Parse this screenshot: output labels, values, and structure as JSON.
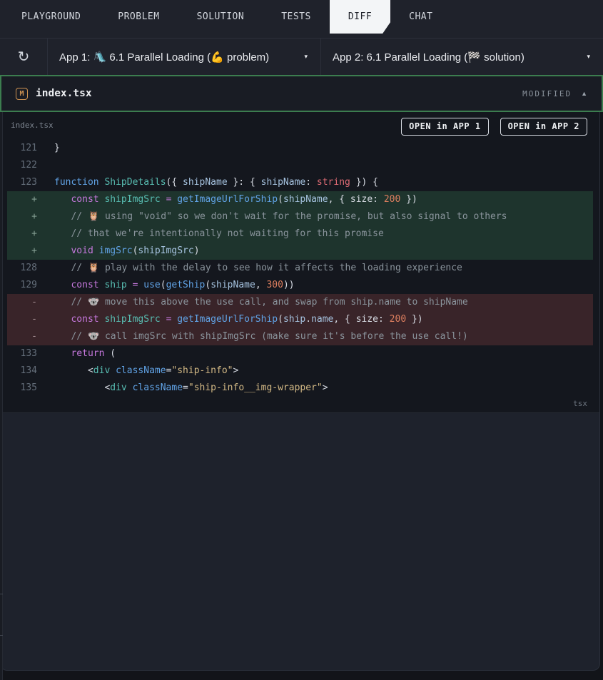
{
  "nav": {
    "tabs": [
      {
        "label": "PLAYGROUND",
        "active": false
      },
      {
        "label": "PROBLEM",
        "active": false
      },
      {
        "label": "SOLUTION",
        "active": false
      },
      {
        "label": "TESTS",
        "active": false
      },
      {
        "label": "DIFF",
        "active": true
      },
      {
        "label": "CHAT",
        "active": false
      }
    ]
  },
  "appbar": {
    "refresh_icon": "↻",
    "caret_icon": "▾",
    "app1_label": "App 1: 🛝 6.1 Parallel Loading (💪 problem)",
    "app2_label": "App 2: 6.1 Parallel Loading (🏁 solution)"
  },
  "file_header": {
    "badge": "M",
    "filename": "index.tsx",
    "status": "MODIFIED",
    "collapse_icon": "▲"
  },
  "colors": {
    "accent_green_border": "#3c7d4f",
    "modified_badge_orange": "#cf9352",
    "added_row_bg": "#1e342d",
    "removed_row_bg": "#392429",
    "active_tab_bg": "#f3f5f7"
  },
  "diff": {
    "file_label": "index.tsx",
    "buttons": [
      "OPEN in APP 1",
      "OPEN in APP 2"
    ],
    "lang_label": "tsx",
    "lines": [
      {
        "num": "121",
        "type": "ctx",
        "tokens": [
          [
            "pl",
            "}"
          ]
        ]
      },
      {
        "num": "122",
        "type": "ctx",
        "tokens": []
      },
      {
        "num": "123",
        "type": "ctx",
        "tokens": [
          [
            "kwb",
            "function "
          ],
          [
            "teal",
            "ShipDetails"
          ],
          [
            "pl",
            "({ "
          ],
          [
            "param",
            "shipName"
          ],
          [
            "pl",
            " }: { "
          ],
          [
            "param",
            "shipName"
          ],
          [
            "pl",
            ": "
          ],
          [
            "type",
            "string"
          ],
          [
            "pl",
            " }) {"
          ]
        ]
      },
      {
        "num": "+",
        "type": "add",
        "tokens": [
          [
            "pl",
            "   "
          ],
          [
            "kw",
            "const "
          ],
          [
            "teal",
            "shipImgSrc"
          ],
          [
            "pl",
            " "
          ],
          [
            "kw",
            "="
          ],
          [
            "pl",
            " "
          ],
          [
            "fn",
            "getImageUrlForShip"
          ],
          [
            "pl",
            "("
          ],
          [
            "param",
            "shipName"
          ],
          [
            "pl",
            ", { size: "
          ],
          [
            "num",
            "200"
          ],
          [
            "pl",
            " })"
          ]
        ]
      },
      {
        "num": "+",
        "type": "add",
        "tokens": [
          [
            "pl",
            "   "
          ],
          [
            "cm",
            "// 🦉 using \"void\" so we don't wait for the promise, but also signal to others"
          ]
        ]
      },
      {
        "num": "+",
        "type": "add",
        "tokens": [
          [
            "pl",
            "   "
          ],
          [
            "cm",
            "// that we're intentionally not waiting for this promise"
          ]
        ]
      },
      {
        "num": "+",
        "type": "add",
        "tokens": [
          [
            "pl",
            "   "
          ],
          [
            "kw",
            "void "
          ],
          [
            "fn",
            "imgSrc"
          ],
          [
            "pl",
            "("
          ],
          [
            "param",
            "shipImgSrc"
          ],
          [
            "pl",
            ")"
          ]
        ]
      },
      {
        "num": "128",
        "type": "ctx",
        "tokens": [
          [
            "pl",
            "   "
          ],
          [
            "cm",
            "// 🦉 play with the delay to see how it affects the loading experience"
          ]
        ]
      },
      {
        "num": "129",
        "type": "ctx",
        "tokens": [
          [
            "pl",
            "   "
          ],
          [
            "kw",
            "const "
          ],
          [
            "teal",
            "ship"
          ],
          [
            "pl",
            " "
          ],
          [
            "kw",
            "="
          ],
          [
            "pl",
            " "
          ],
          [
            "fn",
            "use"
          ],
          [
            "pl",
            "("
          ],
          [
            "fn",
            "getShip"
          ],
          [
            "pl",
            "("
          ],
          [
            "param",
            "shipName"
          ],
          [
            "pl",
            ", "
          ],
          [
            "num",
            "300"
          ],
          [
            "pl",
            "))"
          ]
        ]
      },
      {
        "num": "-",
        "type": "del",
        "tokens": [
          [
            "pl",
            "   "
          ],
          [
            "cm",
            "// 🐨 move this above the use call, and swap from ship.name to shipName"
          ]
        ]
      },
      {
        "num": "-",
        "type": "del",
        "tokens": [
          [
            "pl",
            "   "
          ],
          [
            "kw",
            "const "
          ],
          [
            "teal",
            "shipImgSrc"
          ],
          [
            "pl",
            " "
          ],
          [
            "kw",
            "="
          ],
          [
            "pl",
            " "
          ],
          [
            "fn",
            "getImageUrlForShip"
          ],
          [
            "pl",
            "("
          ],
          [
            "param",
            "ship"
          ],
          [
            "pl",
            "."
          ],
          [
            "param",
            "name"
          ],
          [
            "pl",
            ", { size: "
          ],
          [
            "num",
            "200"
          ],
          [
            "pl",
            " })"
          ]
        ]
      },
      {
        "num": "-",
        "type": "del",
        "tokens": [
          [
            "pl",
            "   "
          ],
          [
            "cm",
            "// 🐨 call imgSrc with shipImgSrc (make sure it's before the use call!)"
          ]
        ]
      },
      {
        "num": "133",
        "type": "ctx",
        "tokens": [
          [
            "pl",
            "   "
          ],
          [
            "kw",
            "return"
          ],
          [
            "pl",
            " ("
          ]
        ]
      },
      {
        "num": "134",
        "type": "ctx",
        "tokens": [
          [
            "pl",
            "      <"
          ],
          [
            "teal",
            "div"
          ],
          [
            "pl",
            " "
          ],
          [
            "fn",
            "className"
          ],
          [
            "pl",
            "="
          ],
          [
            "str",
            "\"ship-info\""
          ],
          [
            "pl",
            ">"
          ]
        ]
      },
      {
        "num": "135",
        "type": "ctx",
        "tokens": [
          [
            "pl",
            "         <"
          ],
          [
            "teal",
            "div"
          ],
          [
            "pl",
            " "
          ],
          [
            "fn",
            "className"
          ],
          [
            "pl",
            "="
          ],
          [
            "str",
            "\"ship-info__img-wrapper\""
          ],
          [
            "pl",
            ">"
          ]
        ]
      }
    ]
  }
}
